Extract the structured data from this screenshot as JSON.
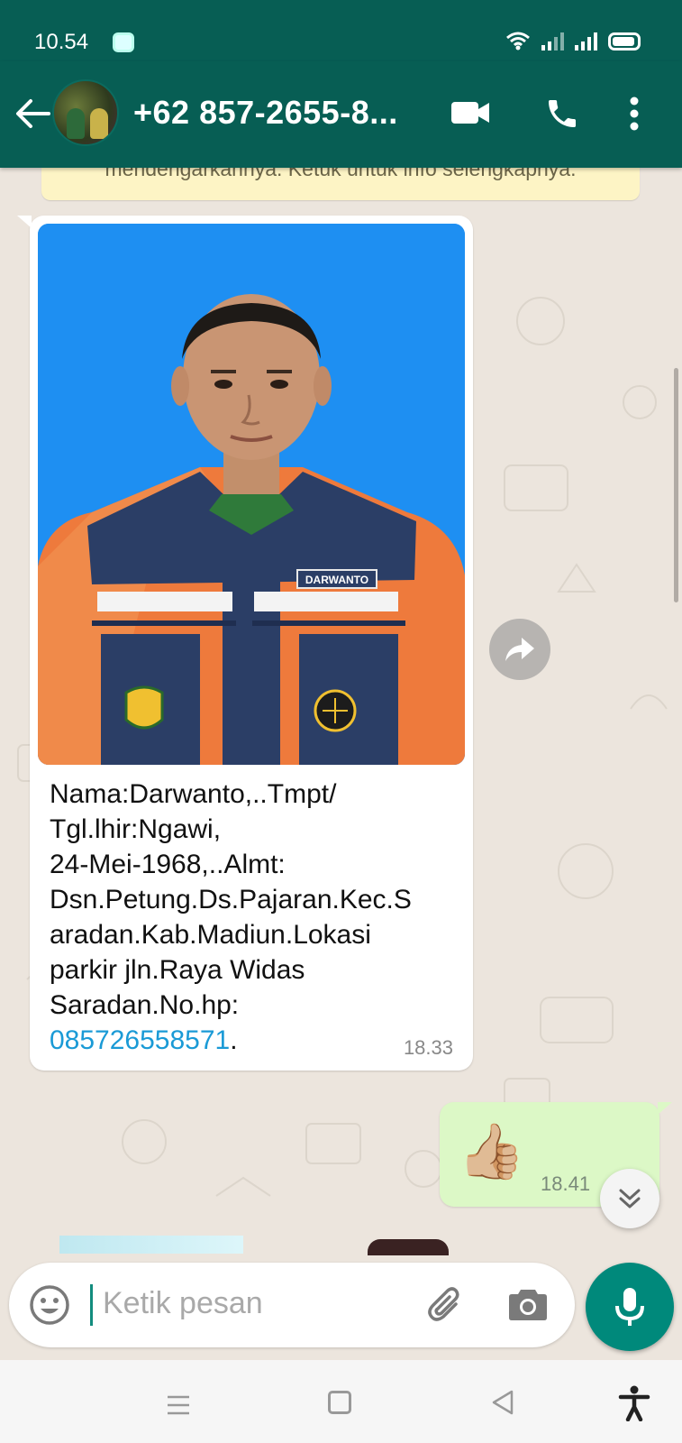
{
  "status_bar": {
    "time": "10.54"
  },
  "header": {
    "contact_name": "+62 857-2655-8..."
  },
  "chat": {
    "notice_text": "mendengarkannya. Ketuk untuk info selengkapnya.",
    "incoming": {
      "text_lines": [
        "Nama:Darwanto,..Tmpt/",
        "Tgl.lhir:Ngawi,",
        "24-Mei-1968,..Almt:",
        "Dsn.Petung.Ds.Pajaran.Kec.S",
        "aradan.Kab.Madiun.Lokasi",
        "parkir jln.Raya Widas",
        "Saradan.No.hp:"
      ],
      "phone_link": "085726558571",
      "trailing": ".",
      "time": "18.33",
      "name_tag": "DARWANTO"
    },
    "outgoing": {
      "emoji": "👍🏼",
      "time": "18.41",
      "ticks": "✓✓"
    }
  },
  "composer": {
    "placeholder": "Ketik pesan"
  },
  "colors": {
    "primary": "#075e54",
    "accent": "#00897b",
    "outgoing_bubble": "#dcf8c6",
    "link": "#1a9ad6"
  },
  "icons": [
    "back-arrow-icon",
    "video-call-icon",
    "phone-icon",
    "more-vert-icon",
    "forward-icon",
    "chevron-double-down-icon",
    "emoji-icon",
    "paperclip-icon",
    "camera-icon",
    "mic-icon",
    "menu-lines-icon",
    "square-icon",
    "triangle-back-icon",
    "accessibility-icon"
  ]
}
